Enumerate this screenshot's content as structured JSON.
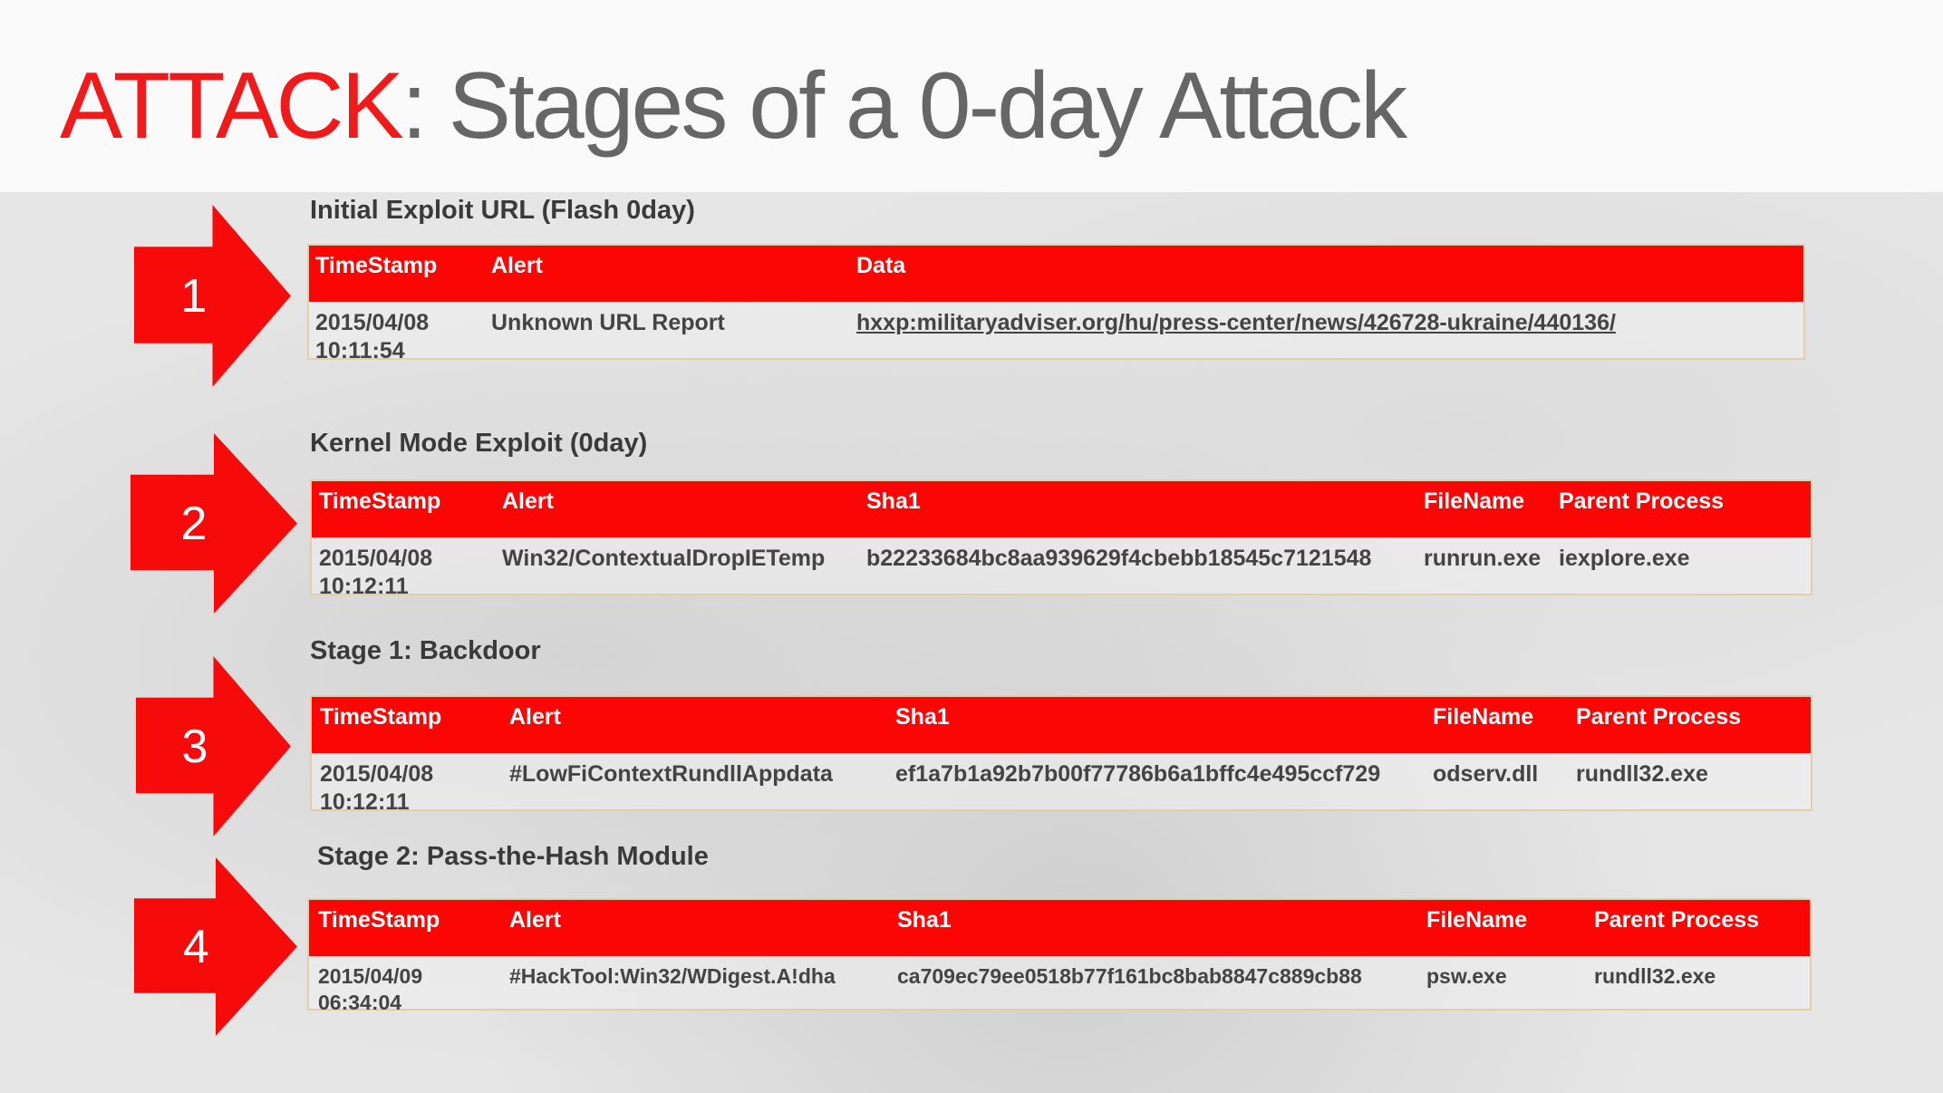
{
  "title": {
    "accent": "ATTACK",
    "rest": ": Stages of a 0-day Attack"
  },
  "colors": {
    "accent": "#f01a1a",
    "header_bg": "#fb0505"
  },
  "stages": [
    {
      "number": "1",
      "label": "Initial Exploit URL (Flash 0day)",
      "columns": [
        "TimeStamp",
        "Alert",
        "Data"
      ],
      "row": [
        "2015/04/08 10:11:54",
        "Unknown URL Report",
        "hxxp:militaryadviser.org/hu/press-center/news/426728-ukraine/440136/"
      ]
    },
    {
      "number": "2",
      "label": "Kernel Mode Exploit (0day)",
      "columns": [
        "TimeStamp",
        "Alert",
        "Sha1",
        "FileName",
        "Parent Process"
      ],
      "row": [
        "2015/04/08 10:12:11",
        "Win32/ContextualDropIETemp",
        "b22233684bc8aa939629f4cbebb18545c7121548",
        "runrun.exe",
        "iexplore.exe"
      ]
    },
    {
      "number": "3",
      "label": "Stage 1: Backdoor",
      "columns": [
        "TimeStamp",
        "Alert",
        "Sha1",
        "FileName",
        "Parent Process"
      ],
      "row": [
        "2015/04/08 10:12:11",
        "#LowFiContextRundllAppdata",
        "ef1a7b1a92b7b00f77786b6a1bffc4e495ccf729",
        "odserv.dll",
        "rundll32.exe"
      ]
    },
    {
      "number": "4",
      "label": "Stage 2: Pass-the-Hash Module",
      "columns": [
        "TimeStamp",
        "Alert",
        "Sha1",
        "FileName",
        "Parent Process"
      ],
      "row": [
        "2015/04/09 06:34:04",
        "#HackTool:Win32/WDigest.A!dha",
        "ca709ec79ee0518b77f161bc8bab8847c889cb88",
        "psw.exe",
        "rundll32.exe"
      ]
    }
  ]
}
